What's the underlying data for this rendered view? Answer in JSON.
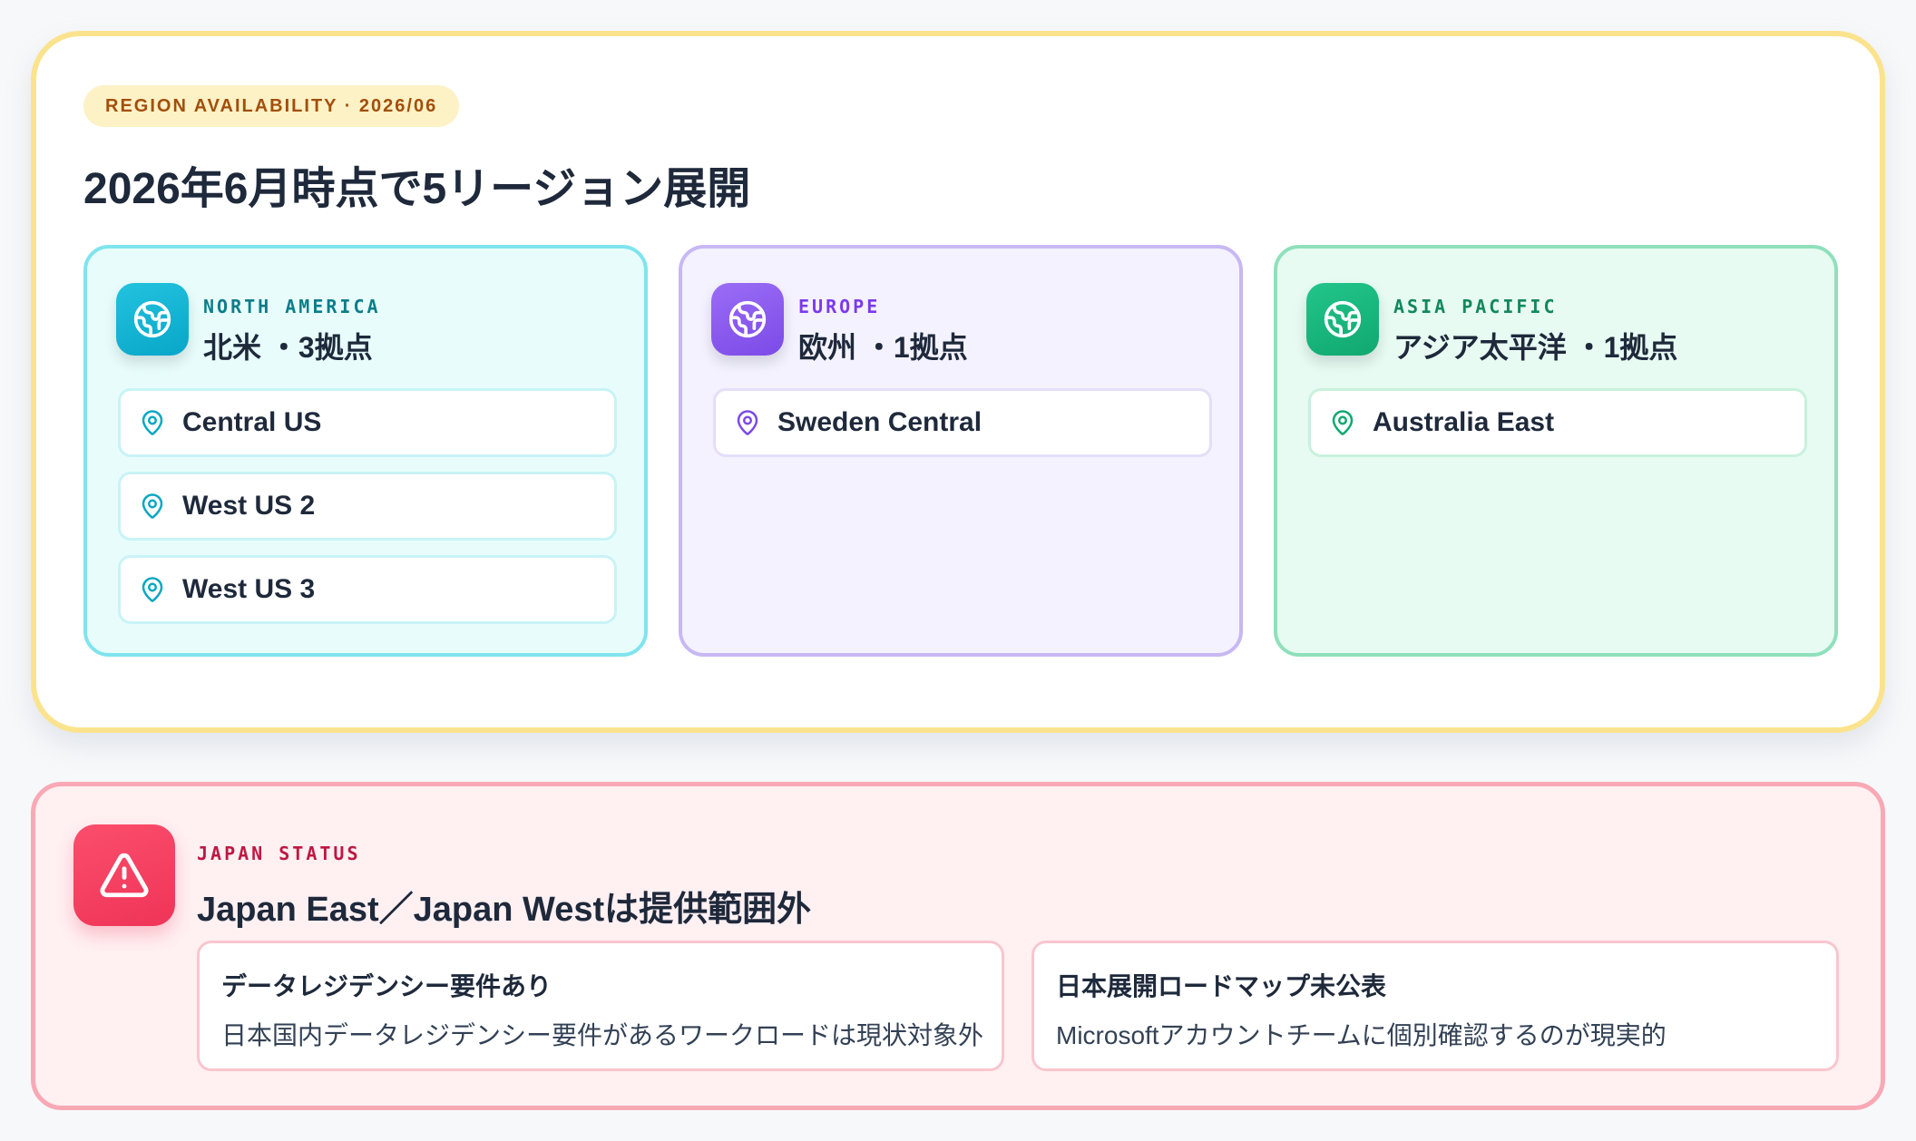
{
  "availability": {
    "tag": "REGION AVAILABILITY · 2026/06",
    "headline": "2026年6月時点で5リージョン展開",
    "regions": [
      {
        "name_en": "NORTH AMERICA",
        "name_jp": "北米 ・3拠点",
        "icon": "globe-icon",
        "accent": "#08a6c8",
        "locations": [
          "Central US",
          "West US 2",
          "West US 3"
        ]
      },
      {
        "name_en": "EUROPE",
        "name_jp": "欧州 ・1拠点",
        "icon": "globe-icon",
        "accent": "#7c4ae8",
        "locations": [
          "Sweden Central"
        ]
      },
      {
        "name_en": "ASIA PACIFIC",
        "name_jp": "アジア太平洋 ・1拠点",
        "icon": "globe-icon",
        "accent": "#10a870",
        "locations": [
          "Australia East"
        ]
      }
    ]
  },
  "japan": {
    "label": "JAPAN STATUS",
    "title": "Japan East／Japan Westは提供範囲外",
    "icon": "warning-icon",
    "accent": "#ef3458",
    "notes": [
      {
        "title": "データレジデンシー要件あり",
        "desc": "日本国内データレジデンシー要件があるワークロードは現状対象外"
      },
      {
        "title": "日本展開ロードマップ未公表",
        "desc": "Microsoftアカウントチームに個別確認するのが現実的"
      }
    ]
  }
}
